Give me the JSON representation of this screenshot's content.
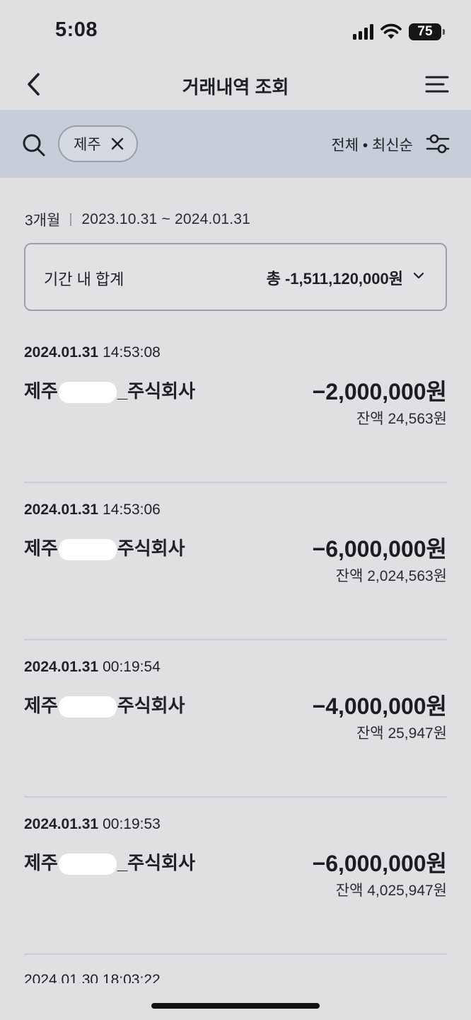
{
  "status_bar": {
    "time": "5:08",
    "battery": "75"
  },
  "nav": {
    "title": "거래내역 조회"
  },
  "filter": {
    "chip_label": "제주",
    "sort_label": "전체 • 최신순"
  },
  "period": {
    "label": "3개월",
    "range": "2023.10.31  ~ 2024.01.31"
  },
  "summary": {
    "label": "기간 내 합계",
    "total": "총 -1,511,120,000원"
  },
  "transactions": [
    {
      "date": "2024.01.31",
      "time": "14:53:08",
      "name_prefix": "제주",
      "name_suffix": "_주식회사",
      "amount": "−2,000,000원",
      "balance": "잔액 24,563원"
    },
    {
      "date": "2024.01.31",
      "time": "14:53:06",
      "name_prefix": "제주",
      "name_suffix": "주식회사",
      "amount": "−6,000,000원",
      "balance": "잔액 2,024,563원"
    },
    {
      "date": "2024.01.31",
      "time": "00:19:54",
      "name_prefix": "제주",
      "name_suffix": "주식회사",
      "amount": "−4,000,000원",
      "balance": "잔액 25,947원"
    },
    {
      "date": "2024.01.31",
      "time": "00:19:53",
      "name_prefix": "제주",
      "name_suffix": "_주식회사",
      "amount": "−6,000,000원",
      "balance": "잔액 4,025,947원"
    }
  ],
  "partial_row": {
    "datetime": "2024.01.30 18:03:22"
  },
  "icons": {
    "back": "chevron-left-icon",
    "menu": "hamburger-menu-icon",
    "search": "search-icon",
    "chip_close": "close-icon",
    "filter": "sliders-icon",
    "expand": "chevron-down-icon"
  }
}
